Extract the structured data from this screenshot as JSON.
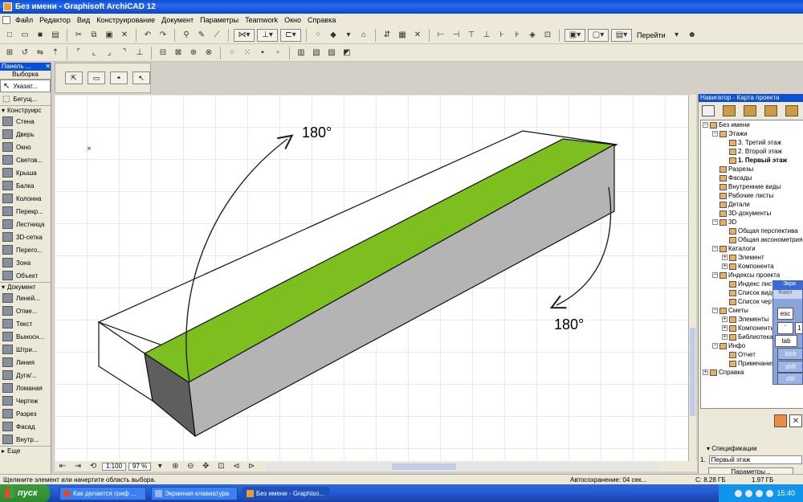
{
  "window": {
    "title": "Без имени - Graphisoft ArchiCAD 12"
  },
  "menu": [
    "Файл",
    "Редактор",
    "Вид",
    "Конструирование",
    "Документ",
    "Параметры",
    "Teamwork",
    "Окно",
    "Справка"
  ],
  "toolbar": {
    "goto_label": "Перейти"
  },
  "left_panel": {
    "title": "Панель ...",
    "selection_label": "Выборка",
    "top_items": [
      "Указат...",
      "Бегущ..."
    ],
    "construction_header": "Конструирс",
    "construction_items": [
      "Стена",
      "Дверь",
      "Окно",
      "Светов...",
      "Крыша",
      "Балка",
      "Колонна",
      "Перекр...",
      "Лестница",
      "3D-сетка",
      "Перего...",
      "Зона",
      "Объект"
    ],
    "document_header": "Документ",
    "document_items": [
      "Линей...",
      "Отме...",
      "Текст",
      "Выносн...",
      "Штри...",
      "Линия",
      "Дуга/...",
      "Ломаная",
      "Чертеж",
      "Разрез",
      "Фасад",
      "Внутр..."
    ],
    "more_label": "Еще"
  },
  "drawing": {
    "label_top": "180°",
    "label_bottom": "180°",
    "top_face_color": "#7cbf1e",
    "side_face_color": "#b4b4b4",
    "end_face_color": "#5e5e5e"
  },
  "bottom_bar": {
    "scale": "1:100",
    "zoom": "97 %"
  },
  "navigator": {
    "title": "Навигатор - Карта проекта",
    "tree": [
      {
        "label": "Без имени",
        "level": 0,
        "exp": "−"
      },
      {
        "label": "Этажи",
        "level": 1,
        "exp": "−"
      },
      {
        "label": "3. Третий этаж",
        "level": 2,
        "exp": ""
      },
      {
        "label": "2. Второй этаж",
        "level": 2,
        "exp": ""
      },
      {
        "label": "1. Первый этаж",
        "level": 2,
        "exp": "",
        "bold": true
      },
      {
        "label": "Разрезы",
        "level": 1,
        "exp": ""
      },
      {
        "label": "Фасады",
        "level": 1,
        "exp": ""
      },
      {
        "label": "Внутренние виды",
        "level": 1,
        "exp": ""
      },
      {
        "label": "Рабочие листы",
        "level": 1,
        "exp": ""
      },
      {
        "label": "Детали",
        "level": 1,
        "exp": ""
      },
      {
        "label": "3D-документы",
        "level": 1,
        "exp": ""
      },
      {
        "label": "3D",
        "level": 1,
        "exp": "−"
      },
      {
        "label": "Общая перспектива",
        "level": 2,
        "exp": ""
      },
      {
        "label": "Общая аксонометрия",
        "level": 2,
        "exp": ""
      },
      {
        "label": "Каталоги",
        "level": 1,
        "exp": "−"
      },
      {
        "label": "Элемент",
        "level": 2,
        "exp": "+"
      },
      {
        "label": "Компонента",
        "level": 2,
        "exp": "+"
      },
      {
        "label": "Индексы проекта",
        "level": 1,
        "exp": "−"
      },
      {
        "label": "Индекс листов",
        "level": 2,
        "exp": ""
      },
      {
        "label": "Список видов",
        "level": 2,
        "exp": ""
      },
      {
        "label": "Список чертежей",
        "level": 2,
        "exp": ""
      },
      {
        "label": "Сметы",
        "level": 1,
        "exp": "−"
      },
      {
        "label": "Элементы",
        "level": 2,
        "exp": "+"
      },
      {
        "label": "Компоненты",
        "level": 2,
        "exp": "+"
      },
      {
        "label": "Библиотека",
        "level": 2,
        "exp": "+"
      },
      {
        "label": "Инфо",
        "level": 1,
        "exp": "−"
      },
      {
        "label": "Отчет",
        "level": 2,
        "exp": ""
      },
      {
        "label": "Примечания",
        "level": 2,
        "exp": ""
      },
      {
        "label": "Справка",
        "level": 0,
        "exp": "+"
      }
    ],
    "spec_header": "Спецификации",
    "spec_number": "1.",
    "spec_value": "Первый этаж",
    "params_button": "Параметры..."
  },
  "keyboard": {
    "title": "Экра",
    "menu": "Файл",
    "keys": [
      "esc",
      "`",
      "1",
      "tab",
      "lock",
      "shft",
      "ctrl"
    ]
  },
  "status": {
    "hint": "Щелкните элемент или начертите область выбора.",
    "autosave": "Автосохранение: 04 сек...",
    "disk": "С: 8.28 ГБ",
    "memory": "1.97 ГБ"
  },
  "taskbar": {
    "start_label": "пуск",
    "tasks": [
      "Как делается гриф ...",
      "Экранная клавиатура",
      "Без имени - Graphiso..."
    ],
    "clock": "15:40"
  }
}
